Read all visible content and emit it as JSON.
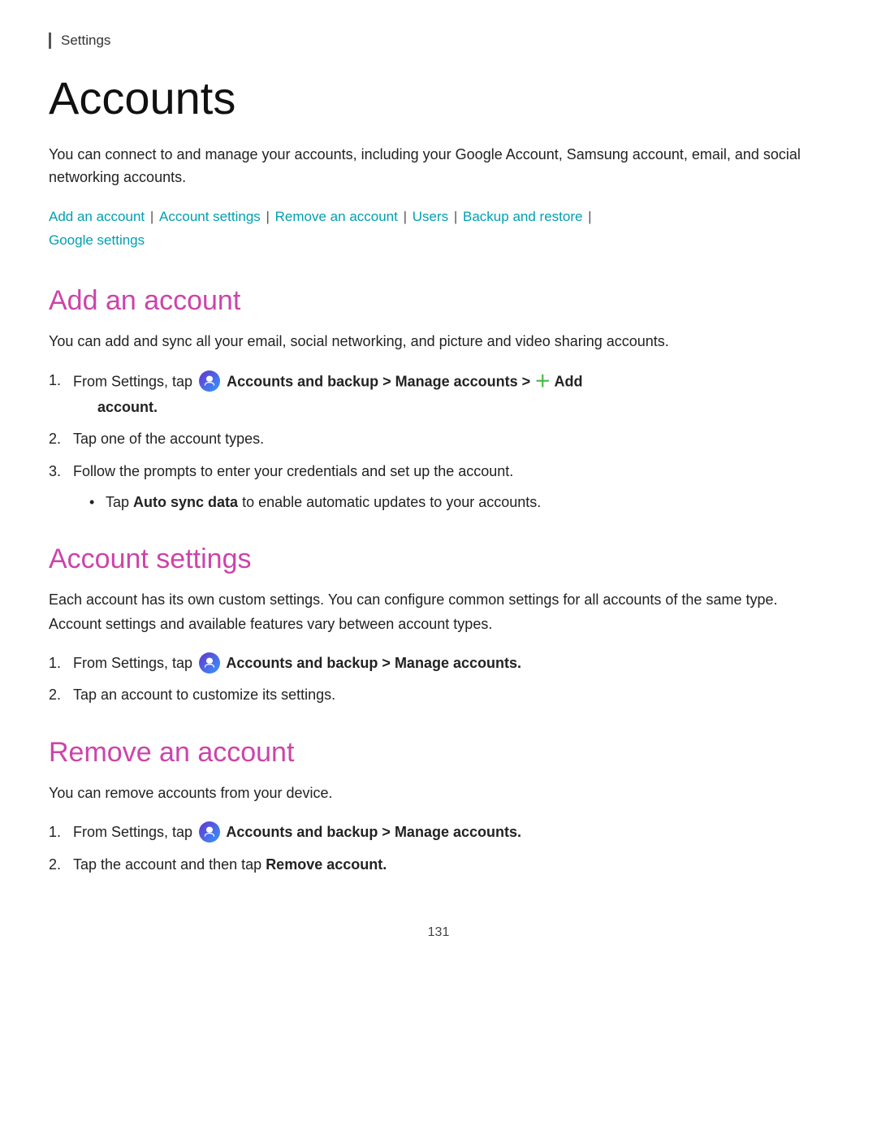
{
  "header": {
    "settings_label": "Settings"
  },
  "page": {
    "title": "Accounts",
    "intro": "You can connect to and manage your accounts, including your Google Account, Samsung account, email, and social networking accounts.",
    "page_number": "131"
  },
  "nav": {
    "links": [
      {
        "label": "Add an account",
        "id": "add"
      },
      {
        "label": "Account settings",
        "id": "settings"
      },
      {
        "label": "Remove an account",
        "id": "remove"
      },
      {
        "label": "Users",
        "id": "users"
      },
      {
        "label": "Backup and restore",
        "id": "backup"
      },
      {
        "label": "Google settings",
        "id": "google"
      }
    ]
  },
  "sections": {
    "add_account": {
      "title": "Add an account",
      "description": "You can add and sync all your email, social networking, and picture and video sharing accounts.",
      "steps": [
        {
          "id": "step1",
          "text_parts": [
            {
              "type": "text",
              "content": "From Settings, tap "
            },
            {
              "type": "icon",
              "content": "accounts-icon"
            },
            {
              "type": "bold",
              "content": " Accounts and backup > Manage accounts > "
            },
            {
              "type": "add-icon",
              "content": "+"
            },
            {
              "type": "bold",
              "content": " Add account."
            }
          ],
          "full_text": "From Settings, tap [icon] Accounts and backup > Manage accounts > [+] Add account."
        },
        {
          "id": "step2",
          "text": "Tap one of the account types."
        },
        {
          "id": "step3",
          "text": "Follow the prompts to enter your credentials and set up the account.",
          "sub_items": [
            {
              "text_before": "Tap ",
              "bold_text": "Auto sync data",
              "text_after": " to enable automatic updates to your accounts."
            }
          ]
        }
      ]
    },
    "account_settings": {
      "title": "Account settings",
      "description": "Each account has its own custom settings. You can configure common settings for all accounts of the same type. Account settings and available features vary between account types.",
      "steps": [
        {
          "id": "step1",
          "text_before": "From Settings, tap ",
          "icon": true,
          "text_bold": " Accounts and backup > Manage accounts."
        },
        {
          "id": "step2",
          "text": "Tap an account to customize its settings."
        }
      ]
    },
    "remove_account": {
      "title": "Remove an account",
      "description": "You can remove accounts from your device.",
      "steps": [
        {
          "id": "step1",
          "text_before": "From Settings, tap ",
          "icon": true,
          "text_bold": " Accounts and backup > Manage accounts."
        },
        {
          "id": "step2",
          "text_before": "Tap the account and then tap ",
          "bold_text": "Remove account."
        }
      ]
    }
  }
}
